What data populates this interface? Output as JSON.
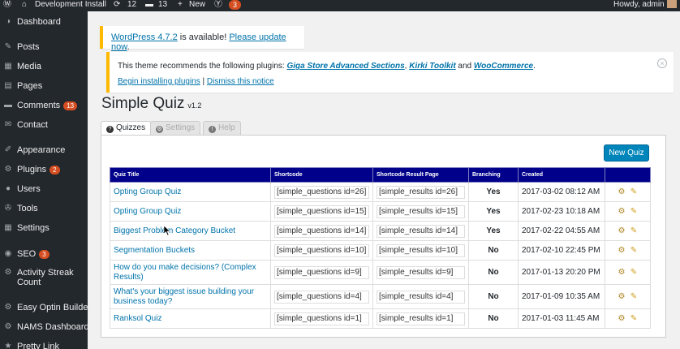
{
  "admin_bar": {
    "site_name": "Development Install",
    "updates_count": "12",
    "comments_count": "13",
    "new_label": "New",
    "seo_count": "3",
    "greeting": "Howdy, admin"
  },
  "sidebar": {
    "items": [
      {
        "label": "Dashboard",
        "icon": "dashboard-icon",
        "glyph": "◑"
      },
      {
        "label": "Posts",
        "icon": "pin-icon",
        "glyph": "✎"
      },
      {
        "label": "Media",
        "icon": "media-icon",
        "glyph": "▦"
      },
      {
        "label": "Pages",
        "icon": "pages-icon",
        "glyph": "▤"
      },
      {
        "label": "Comments",
        "icon": "comments-icon",
        "glyph": "▬",
        "badge": "13"
      },
      {
        "label": "Contact",
        "icon": "mail-icon",
        "glyph": "✉"
      },
      {
        "label": "Appearance",
        "icon": "brush-icon",
        "glyph": "✐"
      },
      {
        "label": "Plugins",
        "icon": "plugin-icon",
        "glyph": "⚙",
        "badge": "2"
      },
      {
        "label": "Users",
        "icon": "users-icon",
        "glyph": "●"
      },
      {
        "label": "Tools",
        "icon": "tools-icon",
        "glyph": "✇"
      },
      {
        "label": "Settings",
        "icon": "settings-icon",
        "glyph": "▦"
      },
      {
        "label": "SEO",
        "icon": "seo-icon",
        "glyph": "◉",
        "badge": "3"
      },
      {
        "label": "Activity Streak Count",
        "icon": "gear-icon",
        "glyph": "⚙"
      },
      {
        "label": "Easy Optin Builder",
        "icon": "gear-icon",
        "glyph": "⚙"
      },
      {
        "label": "NAMS Dashboard",
        "icon": "gear-icon",
        "glyph": "⚙"
      },
      {
        "label": "Pretty Link",
        "icon": "link-icon",
        "glyph": "★"
      }
    ]
  },
  "notice_update": {
    "link1": "WordPress 4.7.2",
    "text1": " is available! ",
    "link2": "Please update now",
    "text2": "."
  },
  "notice_plugins": {
    "text": "This theme recommends the following plugins: ",
    "plugin1": "Giga Store Advanced Sections",
    "sep1": ", ",
    "plugin2": "Kirki Toolkit",
    "sep2": " and ",
    "plugin3": "WooCommerce",
    "end": ".",
    "action1": "Begin installing plugins",
    "separator": " | ",
    "action2": "Dismiss this notice"
  },
  "page": {
    "title": "Simple Quiz",
    "version": "v1.2"
  },
  "tabs": [
    {
      "label": "Quizzes",
      "glyph": "?"
    },
    {
      "label": "Settings",
      "glyph": "⚙"
    },
    {
      "label": "Help",
      "glyph": "!"
    }
  ],
  "new_quiz_label": "New Quiz",
  "table": {
    "headers": [
      "Quiz Title",
      "Shortcode",
      "Shortcode Result Page",
      "Branching",
      "Created",
      ""
    ],
    "rows": [
      {
        "title": "Opting Group Quiz",
        "shortcode": "[simple_questions id=26]",
        "result": "[simple_results id=26]",
        "branching": "Yes",
        "created": "2017-03-02 08:12 AM"
      },
      {
        "title": "Opting Group Quiz",
        "shortcode": "[simple_questions id=15]",
        "result": "[simple_results id=15]",
        "branching": "Yes",
        "created": "2017-02-23 10:18 AM"
      },
      {
        "title": "Biggest Problem Category Bucket",
        "shortcode": "[simple_questions id=14]",
        "result": "[simple_results id=14]",
        "branching": "Yes",
        "created": "2017-02-22 04:55 AM"
      },
      {
        "title": "Segmentation Buckets",
        "shortcode": "[simple_questions id=10]",
        "result": "[simple_results id=10]",
        "branching": "No",
        "created": "2017-02-10 22:45 PM"
      },
      {
        "title": "How do you make decisions? (Complex Results)",
        "shortcode": "[simple_questions id=9]",
        "result": "[simple_results id=9]",
        "branching": "No",
        "created": "2017-01-13 20:20 PM"
      },
      {
        "title": "What's your biggest issue building your business today?",
        "shortcode": "[simple_questions id=4]",
        "result": "[simple_results id=4]",
        "branching": "No",
        "created": "2017-01-09 10:35 AM"
      },
      {
        "title": "Ranksol Quiz",
        "shortcode": "[simple_questions id=1]",
        "result": "[simple_results id=1]",
        "branching": "No",
        "created": "2017-01-03 11:45 AM"
      }
    ]
  },
  "colors": {
    "admin_bar": "#23282d",
    "notice_border": "#ffb900",
    "link": "#0073aa",
    "table_header": "#00008b",
    "primary_button": "#0085ba",
    "badge": "#d54e21"
  }
}
